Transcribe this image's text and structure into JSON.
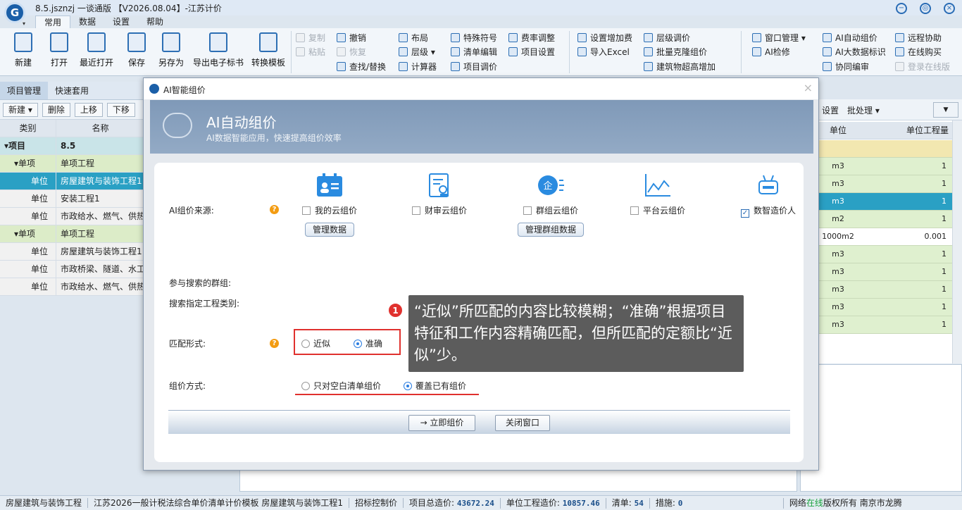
{
  "app": {
    "title": "8.5.jsznzj 一谈通版 【V2026.08.04】-江苏计价",
    "menu_tabs": [
      "常用",
      "数据",
      "设置",
      "帮助"
    ]
  },
  "ribbon": {
    "big_buttons": [
      "新建",
      "打开",
      "最近打开",
      "保存",
      "另存为",
      "导出电子标书",
      "转换模板"
    ],
    "clipboard": {
      "copy": "复制",
      "paste": "粘贴",
      "undo": "撤销",
      "redo": "恢复",
      "find_replace": "查找/替换"
    },
    "group2": [
      "布局",
      "层级",
      "计算器",
      "特殊符号",
      "清单编辑",
      "项目调价",
      "费率调整",
      "项目设置"
    ],
    "group3": [
      "设置增加费",
      "导入Excel",
      "层级调价",
      "批量克隆组价",
      "建筑物超高增加"
    ],
    "group4": [
      "窗口管理",
      "AI检修",
      "AI自动组价",
      "AI大数据标识",
      "协同编审",
      "远程协助",
      "在线购买",
      "登录在线版"
    ]
  },
  "left_panel": {
    "tabs": [
      "项目管理",
      "快速套用"
    ],
    "toolbar": [
      "新建",
      "删除",
      "上移",
      "下移"
    ],
    "columns": [
      "类别",
      "名称"
    ],
    "rows": [
      {
        "type": "▾项目",
        "name": "8.5"
      },
      {
        "type": "▾单项",
        "name": "单项工程"
      },
      {
        "type": "单位",
        "name": "房屋建筑与装饰工程1"
      },
      {
        "type": "单位",
        "name": "安装工程1"
      },
      {
        "type": "单位",
        "name": "市政给水、燃气、供热"
      },
      {
        "type": "▾单项",
        "name": "单项工程"
      },
      {
        "type": "单位",
        "name": "房屋建筑与装饰工程1"
      },
      {
        "type": "单位",
        "name": "市政桥梁、隧道、水工"
      },
      {
        "type": "单位",
        "name": "市政给水、燃气、供热"
      }
    ]
  },
  "right_panel": {
    "toolbar": [
      "设置",
      "批处理"
    ],
    "columns": [
      "单位",
      "单位工程量"
    ],
    "rows": [
      {
        "unit": "m3",
        "qty": "1"
      },
      {
        "unit": "m3",
        "qty": "1"
      },
      {
        "unit": "m3",
        "qty": "1"
      },
      {
        "unit": "m2",
        "qty": "1"
      },
      {
        "unit": "1000m2",
        "qty": "0.001"
      },
      {
        "unit": "m3",
        "qty": "1"
      },
      {
        "unit": "m3",
        "qty": "1"
      },
      {
        "unit": "m3",
        "qty": "1"
      },
      {
        "unit": "m3",
        "qty": "1"
      },
      {
        "unit": "m3",
        "qty": "1"
      }
    ]
  },
  "dialog": {
    "title": "AI智能组价",
    "header_title": "AI自动组价",
    "header_subtitle": "AI数据智能应用，快速提高组价效率",
    "source_label": "AI组价来源:",
    "sources": [
      {
        "label": "我的云组价",
        "checked": false,
        "button": "管理数据"
      },
      {
        "label": "财审云组价",
        "checked": false,
        "button": ""
      },
      {
        "label": "群组云组价",
        "checked": false,
        "button": "管理群组数据"
      },
      {
        "label": "平台云组价",
        "checked": false,
        "button": ""
      },
      {
        "label": "数智造价人",
        "checked": true,
        "button": ""
      }
    ],
    "group_label": "参与搜索的群组:",
    "category_label": "搜索指定工程类别:",
    "match_label": "匹配形式:",
    "match_options": [
      "近似",
      "准确"
    ],
    "match_selected": "准确",
    "method_label": "组价方式:",
    "method_options": [
      "只对空白清单组价",
      "覆盖已有组价"
    ],
    "method_selected": "覆盖已有组价",
    "btn_start": "→ 立即组价",
    "btn_close": "关闭窗口"
  },
  "tooltip": {
    "badge": "1",
    "text": "“近似”所匹配的内容比较模糊；“准确”根据项目特征和工作内容精确匹配，但所匹配的定额比“近似”少。"
  },
  "statusbar": {
    "project": "房屋建筑与装饰工程",
    "template": "江苏2026一般计税法综合单价清单计价模板",
    "unit_name": "房屋建筑与装饰工程1",
    "mode": "招标控制价",
    "total_label": "项目总造价:",
    "total_value": "43672.24",
    "unit_label": "单位工程造价:",
    "unit_value": "10857.46",
    "list_label": "清单:",
    "list_value": "54",
    "measure_label": "措施:",
    "measure_value": "0",
    "net_prefix": "网络",
    "net_status": "在线",
    "copyright": "版权所有 南京市龙腾"
  }
}
